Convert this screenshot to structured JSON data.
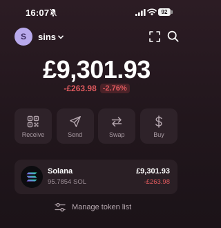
{
  "status_bar": {
    "time": "16:07",
    "battery": "92"
  },
  "header": {
    "avatar_letter": "S",
    "account_name": "sins"
  },
  "balance": {
    "total": "£9,301.93",
    "change_value": "-£263.98",
    "change_percent": "-2.76%"
  },
  "actions": [
    {
      "label": "Receive",
      "icon": "qr-code-icon"
    },
    {
      "label": "Send",
      "icon": "send-icon"
    },
    {
      "label": "Swap",
      "icon": "swap-icon"
    },
    {
      "label": "Buy",
      "icon": "dollar-icon"
    }
  ],
  "tokens": [
    {
      "name": "Solana",
      "amount": "95.7854 SOL",
      "value": "£9,301.93",
      "change": "-£263.98",
      "icon": "solana-icon"
    }
  ],
  "manage_token_list": {
    "label": "Manage token list",
    "icon": "sliders-icon"
  },
  "colors": {
    "background": "#2c1c24",
    "negative": "#e05a5e",
    "avatar": "#b8a9ec",
    "card": "#2e2229"
  }
}
